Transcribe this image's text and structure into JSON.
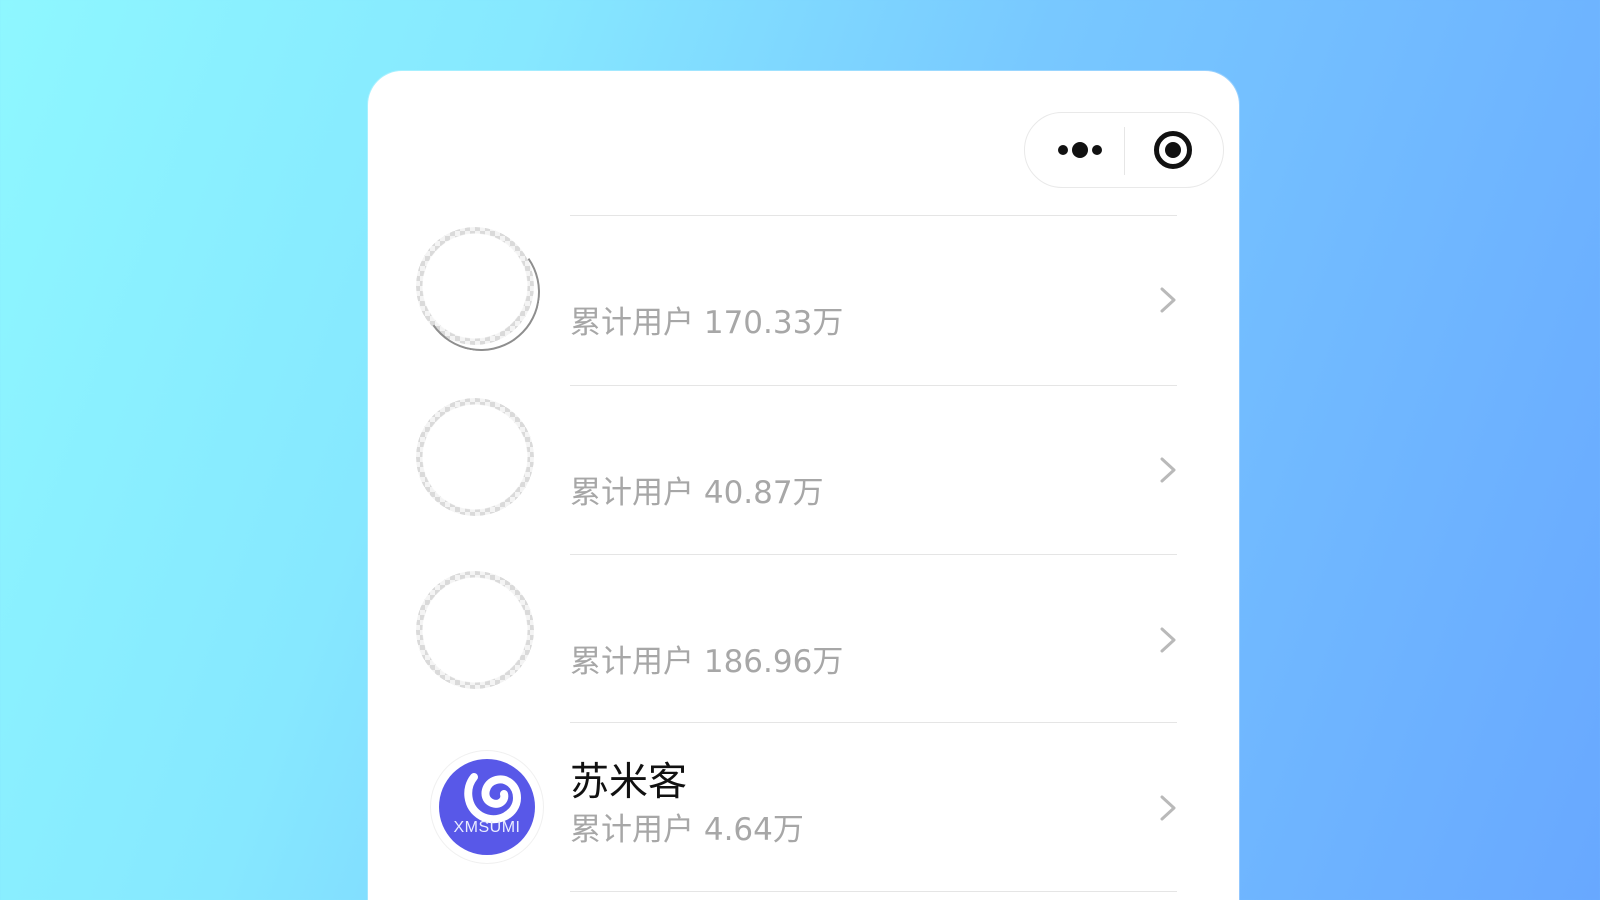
{
  "top_bar": {
    "more_icon": "more-dots-icon",
    "close_icon": "target-close-icon"
  },
  "list": {
    "items": [
      {
        "title": "",
        "subtitle": "累计用户 170.33万",
        "avatar": "placeholder"
      },
      {
        "title": "",
        "subtitle": "累计用户 40.87万",
        "avatar": "placeholder"
      },
      {
        "title": "",
        "subtitle": "累计用户 186.96万",
        "avatar": "placeholder"
      },
      {
        "title": "苏米客",
        "subtitle": "累计用户 4.64万",
        "avatar_text": "XMSUMI",
        "avatar_color": "#5858e8"
      }
    ]
  },
  "colors": {
    "panel_bg": "#ffffff",
    "text_primary": "#111111",
    "text_secondary": "#a7a7a7",
    "divider": "#e5e5e5",
    "brand_avatar": "#5858e8"
  }
}
